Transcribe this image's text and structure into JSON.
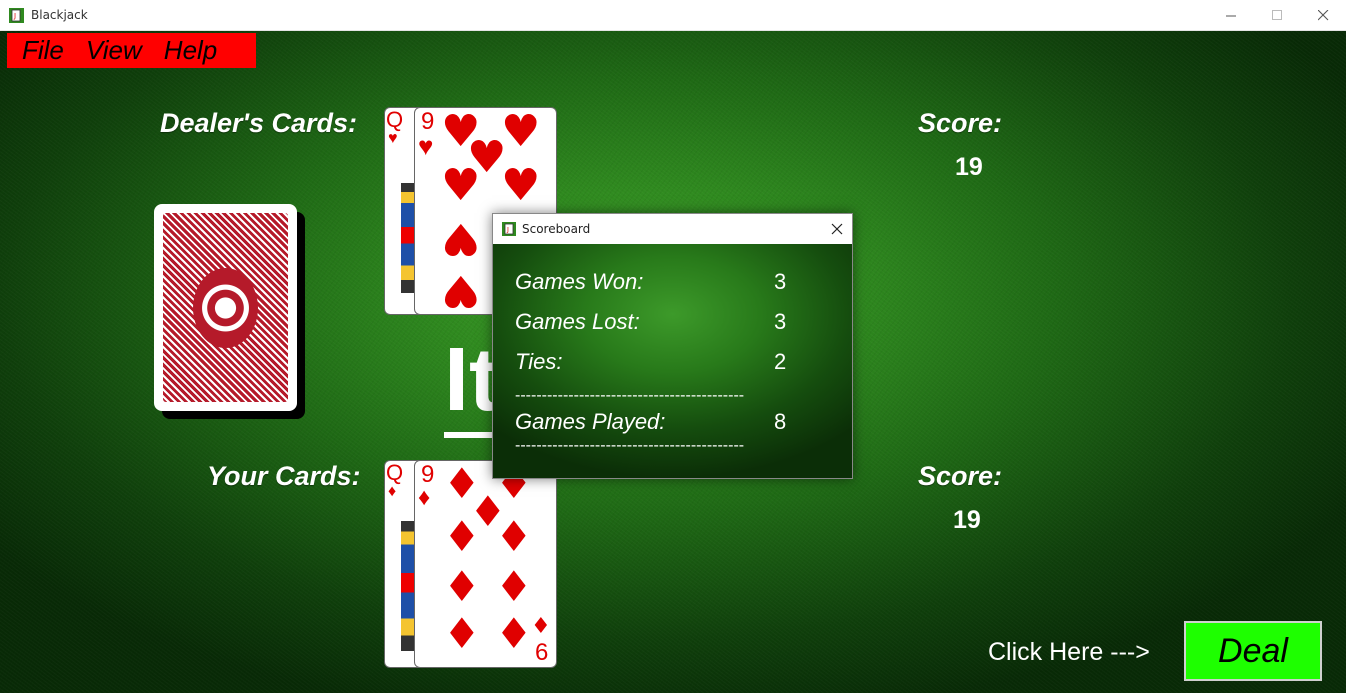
{
  "window": {
    "title": "Blackjack",
    "minimize": "—",
    "maximize": "☐",
    "close": "✕"
  },
  "menu": {
    "file": "File",
    "view": "View",
    "help": "Help"
  },
  "dealer": {
    "label": "Dealer's Cards:",
    "score_label": "Score:",
    "score": "19",
    "cards": [
      {
        "rank": "Q",
        "suit": "♥",
        "face": true
      },
      {
        "rank": "9",
        "suit": "♥"
      }
    ]
  },
  "player": {
    "label": "Your Cards:",
    "score_label": "Score:",
    "score": "19",
    "cards": [
      {
        "rank": "Q",
        "suit": "♦",
        "face": true
      },
      {
        "rank": "9",
        "suit": "♦",
        "bottom_rank": "6"
      }
    ]
  },
  "result_text": "It",
  "deal": {
    "hint": "Click Here --->",
    "label": "Deal"
  },
  "scoreboard": {
    "title": "Scoreboard",
    "close": "✕",
    "games_won_label": "Games Won:",
    "games_won": "3",
    "games_lost_label": "Games Lost:",
    "games_lost": "3",
    "ties_label": "Ties:",
    "ties": "2",
    "divider": "-------------------------------------------",
    "games_played_label": "Games Played:",
    "games_played": "8"
  },
  "colors": {
    "felt": "#2f8a1f",
    "menu_bg": "#ff0000",
    "deal_bg": "#1eff00",
    "card_red": "#e00000"
  }
}
